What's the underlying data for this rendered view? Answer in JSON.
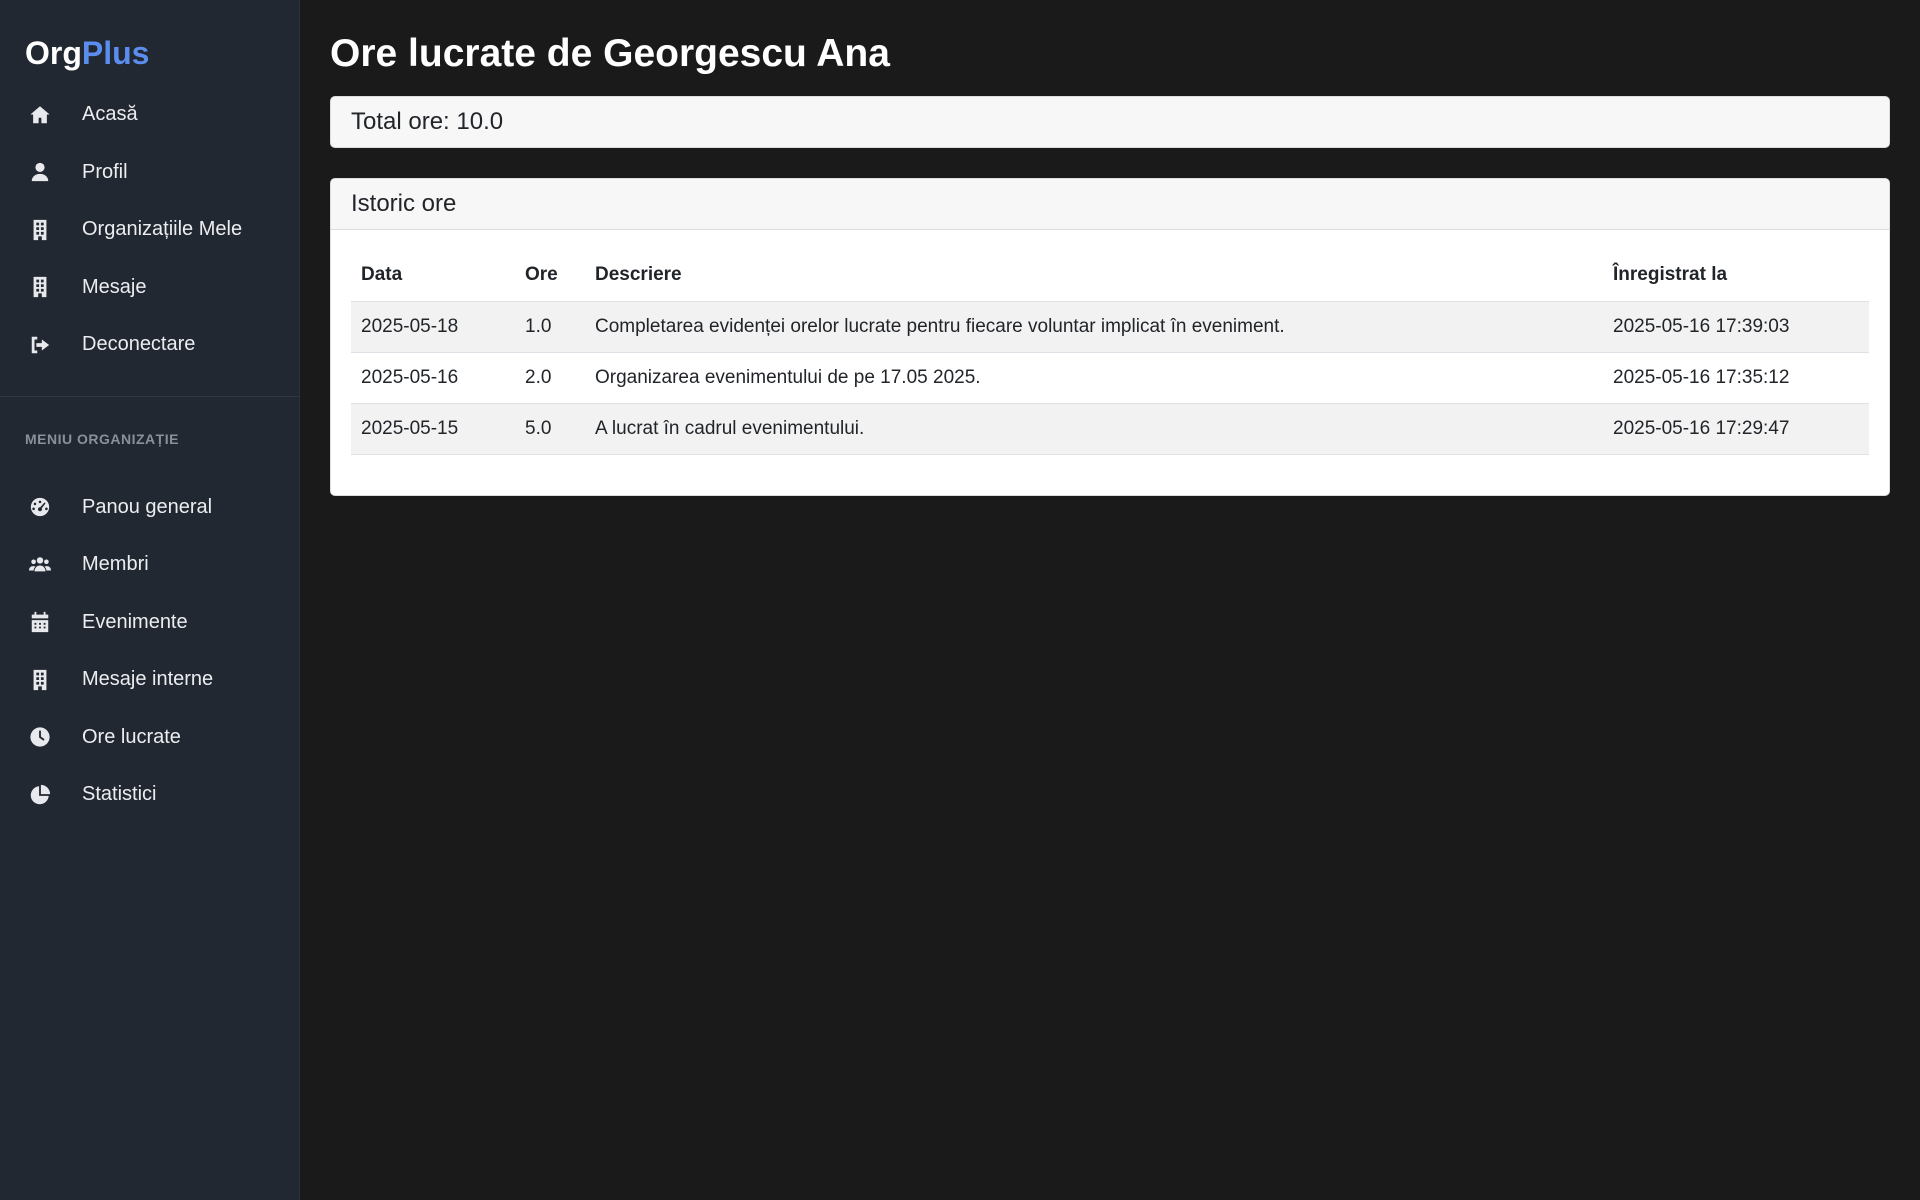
{
  "brand": {
    "part1": "Org",
    "part2": "Plus"
  },
  "sidebar": {
    "main_items": [
      {
        "label": "Acasă",
        "icon": "home-icon"
      },
      {
        "label": "Profil",
        "icon": "user-icon"
      },
      {
        "label": "Organizațiile Mele",
        "icon": "building-icon"
      },
      {
        "label": "Mesaje",
        "icon": "building-icon"
      },
      {
        "label": "Deconectare",
        "icon": "logout-icon"
      }
    ],
    "section_title": "MENIU ORGANIZAȚIE",
    "org_items": [
      {
        "label": "Panou general",
        "icon": "dashboard-icon"
      },
      {
        "label": "Membri",
        "icon": "users-icon"
      },
      {
        "label": "Evenimente",
        "icon": "calendar-icon"
      },
      {
        "label": "Mesaje interne",
        "icon": "building-icon"
      },
      {
        "label": "Ore lucrate",
        "icon": "clock-icon"
      },
      {
        "label": "Statistici",
        "icon": "pie-chart-icon"
      }
    ]
  },
  "main": {
    "title": "Ore lucrate de Georgescu Ana",
    "total": "Total ore: 10.0",
    "history": {
      "title": "Istoric ore",
      "columns": [
        "Data",
        "Ore",
        "Descriere",
        "Înregistrat la"
      ],
      "rows": [
        [
          "2025-05-18",
          "1.0",
          "Completarea evidenței orelor lucrate pentru fiecare voluntar implicat în eveniment.",
          "2025-05-16 17:39:03"
        ],
        [
          "2025-05-16",
          "2.0",
          "Organizarea evenimentului de pe 17.05 2025.",
          "2025-05-16 17:35:12"
        ],
        [
          "2025-05-15",
          "5.0",
          "A lucrat în cadrul evenimentului.",
          "2025-05-16 17:29:47"
        ]
      ]
    }
  },
  "colors": {
    "accent": "#5b8def",
    "sidebar_bg": "#222831",
    "page_bg": "#1a1a1a"
  }
}
